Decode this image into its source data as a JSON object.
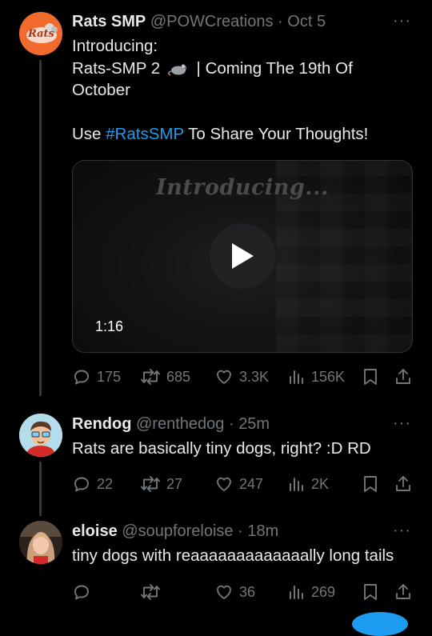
{
  "posts": [
    {
      "name": "Rats SMP",
      "handle": "@POWCreations",
      "sep": "·",
      "time": "Oct 5",
      "more": "···",
      "avatar_text": "Rats",
      "text_lines": [
        "Introducing:",
        "Rats-SMP 2",
        "| Coming The 19th Of",
        "October"
      ],
      "text_line3_prefix": "Use ",
      "hashtag": "#RatsSMP",
      "text_line3_suffix": " To Share Your Thoughts!",
      "emoji_icon": "rat-icon",
      "video": {
        "overlay_title": "Introducing...",
        "duration": "1:16"
      },
      "actions": {
        "replies": "175",
        "reposts": "685",
        "likes": "3.3K",
        "views": "156K"
      }
    },
    {
      "name": "Rendog",
      "handle": "@renthedog",
      "sep": "·",
      "time": "25m",
      "more": "···",
      "text": "Rats are basically tiny dogs, right? :D RD",
      "actions": {
        "replies": "22",
        "reposts": "27",
        "likes": "247",
        "views": "2K"
      }
    },
    {
      "name": "eloise",
      "handle": "@soupforeloise",
      "sep": "·",
      "time": "18m",
      "more": "···",
      "text": "tiny dogs with reaaaaaaaaaaaaally long tails",
      "actions": {
        "replies": "",
        "reposts": "",
        "likes": "36",
        "views": "269"
      }
    }
  ],
  "colors": {
    "background": "#000000",
    "text": "#e7e9ea",
    "muted": "#71767b",
    "link": "#1d9bf0",
    "thread_line": "#333639"
  }
}
